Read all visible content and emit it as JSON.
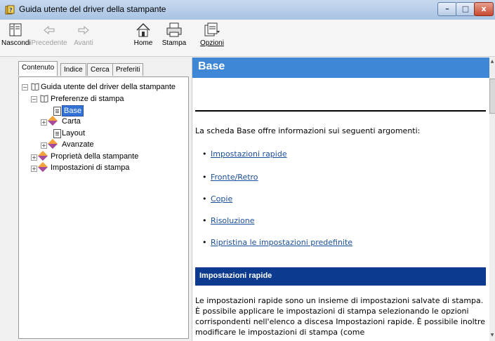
{
  "window": {
    "title": "Guida utente del driver della stampante",
    "controls": {
      "minimize": "–",
      "maximize": "□",
      "close": "x"
    }
  },
  "toolbar": {
    "hide": "Nascondi",
    "back": "Precedente",
    "forward": "Avanti",
    "home": "Home",
    "print": "Stampa",
    "options": "Opzioni"
  },
  "tabs": [
    "Contenuto",
    "Indice",
    "Cerca",
    "Preferiti"
  ],
  "tree": {
    "root": "Guida utente del driver della stampante",
    "preferences": "Preferenze di stampa",
    "base": "Base",
    "paper": "Carta",
    "layout": "Layout",
    "advanced": "Avanzate",
    "properties": "Proprietà della stampante",
    "settings": "Impostazioni di stampa"
  },
  "content": {
    "title": "Base",
    "intro": "La scheda Base offre informazioni sui seguenti argomenti:",
    "links": [
      "Impostazioni rapide",
      "Fronte/Retro",
      "Copie",
      "Risoluzione",
      "Ripristina le impostazioni predefinite"
    ],
    "section_title": "Impostazioni rapide",
    "paragraph": "Le impostazioni rapide sono un insieme di impostazioni salvate di stampa. È possibile applicare le impostazioni di stampa selezionando le opzioni corrispondenti nell'elenco a discesa Impostazioni rapide. È possibile inoltre modificare le impostazioni di stampa (come"
  },
  "colors": {
    "header_blue": "#3e87d6",
    "section_blue": "#0b3a8f",
    "link": "#1a4e9a",
    "selection": "#3373d8"
  }
}
